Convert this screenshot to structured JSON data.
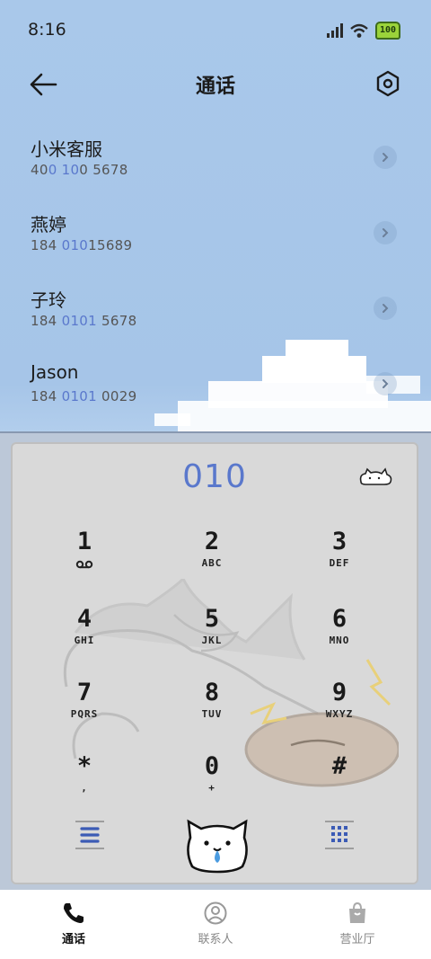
{
  "status": {
    "time": "8:16",
    "battery": "100"
  },
  "header": {
    "title": "通话"
  },
  "contacts": [
    {
      "name": "小米客服",
      "num_parts": [
        "40",
        "0",
        " ",
        "10",
        "0 5678"
      ]
    },
    {
      "name": "燕婷",
      "num_parts": [
        "184 ",
        "010",
        "15689",
        "",
        ""
      ]
    },
    {
      "name": "子玲",
      "num_parts": [
        "184 ",
        "0101",
        " 5678",
        "",
        ""
      ]
    },
    {
      "name": "Jason",
      "num_parts": [
        "184 ",
        "0101",
        " 0029",
        "",
        ""
      ]
    }
  ],
  "dialer": {
    "input": "010",
    "keys": [
      {
        "digit": "1",
        "sub": ""
      },
      {
        "digit": "2",
        "sub": "ABC"
      },
      {
        "digit": "3",
        "sub": "DEF"
      },
      {
        "digit": "4",
        "sub": "GHI"
      },
      {
        "digit": "5",
        "sub": "JKL"
      },
      {
        "digit": "6",
        "sub": "MNO"
      },
      {
        "digit": "7",
        "sub": "PQRS"
      },
      {
        "digit": "8",
        "sub": "TUV"
      },
      {
        "digit": "9",
        "sub": "WXYZ"
      },
      {
        "digit": "*",
        "sub": ","
      },
      {
        "digit": "0",
        "sub": "+"
      },
      {
        "digit": "#",
        "sub": ""
      }
    ]
  },
  "nav": {
    "tabs": [
      {
        "label": "通话",
        "icon": "phone-icon",
        "active": true
      },
      {
        "label": "联系人",
        "icon": "contacts-icon",
        "active": false
      },
      {
        "label": "营业厅",
        "icon": "store-icon",
        "active": false
      }
    ]
  },
  "colors": {
    "accent": "#5a78cc",
    "sky": "#a9c8ea",
    "dialpad_bg": "#d9d9d9"
  }
}
